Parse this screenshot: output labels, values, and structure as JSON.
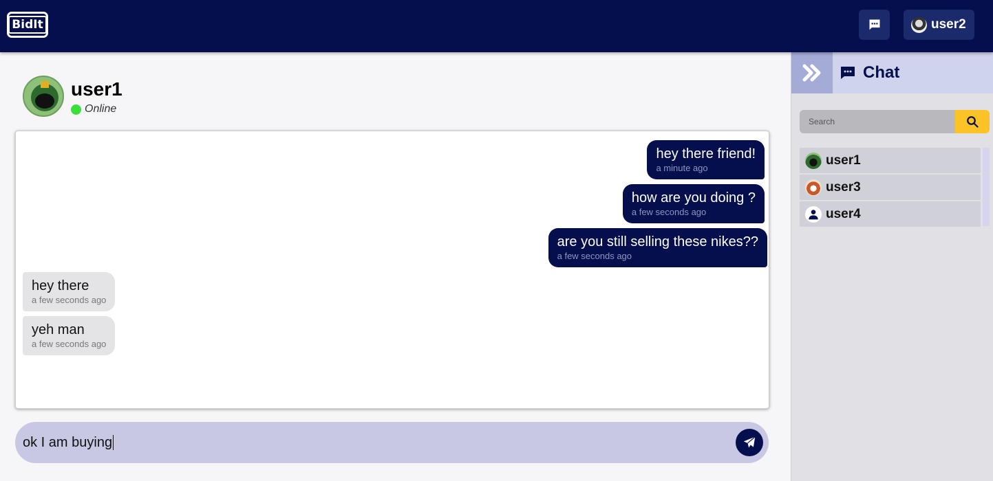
{
  "brand": {
    "logo_text": "BidIt"
  },
  "topbar": {
    "current_user": "user2"
  },
  "chat": {
    "contact_name": "user1",
    "status": "Online",
    "messages": [
      {
        "direction": "out",
        "text": "hey there friend!",
        "time": "a minute ago"
      },
      {
        "direction": "out",
        "text": "how are you doing ?",
        "time": "a few seconds ago"
      },
      {
        "direction": "out",
        "text": "are you still selling these nikes??",
        "time": "a few seconds ago"
      },
      {
        "direction": "in",
        "text": "hey there",
        "time": "a few seconds ago"
      },
      {
        "direction": "in",
        "text": "yeh man",
        "time": "a few seconds ago"
      }
    ],
    "composer_value": "ok I am buying"
  },
  "sidebar": {
    "title": "Chat",
    "search_placeholder": "Search",
    "users": [
      {
        "name": "user1"
      },
      {
        "name": "user3"
      },
      {
        "name": "user4"
      }
    ]
  },
  "colors": {
    "navy": "#050f4e",
    "accent_yellow": "#fbc325",
    "online_green": "#3adf3a",
    "composer_bg": "#c8c8e4"
  },
  "icons": {
    "top_chat": "chat-bubble-icon",
    "send": "paper-plane-icon",
    "collapse": "double-chevron-right-icon",
    "search": "search-icon",
    "default_user": "person-icon"
  }
}
